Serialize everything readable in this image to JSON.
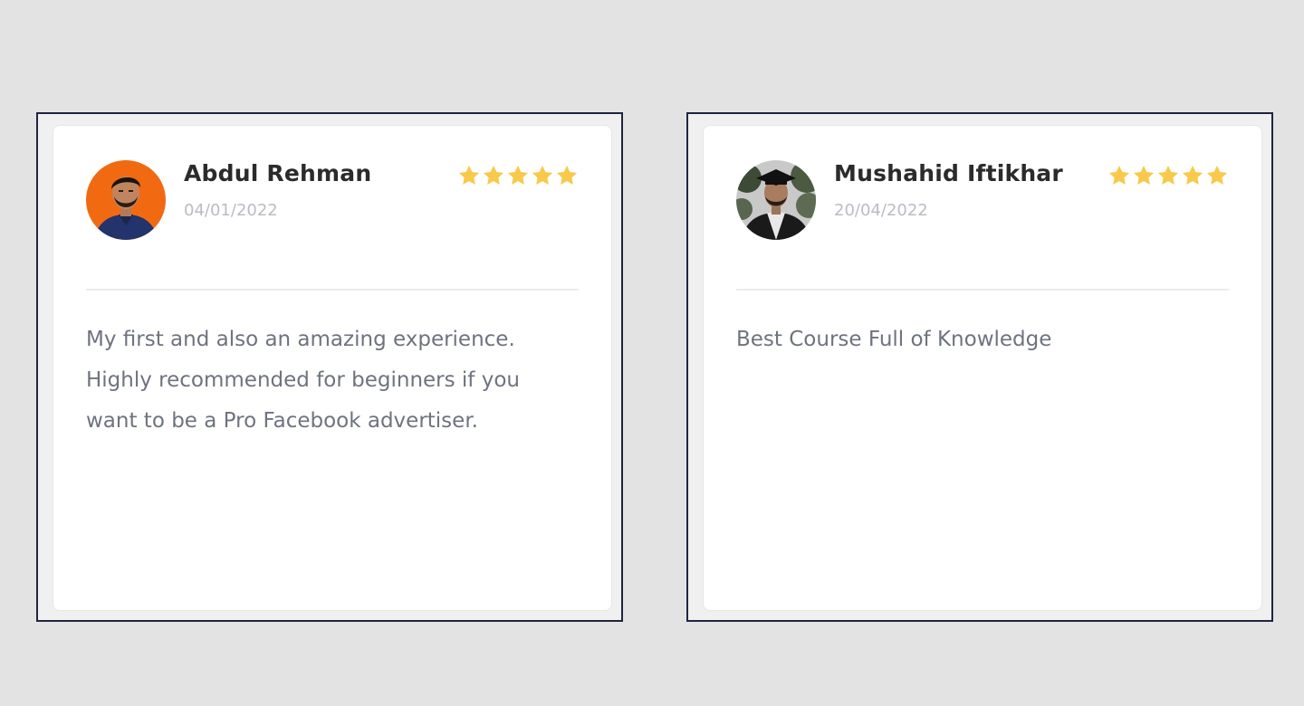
{
  "reviews": [
    {
      "name": "Abdul Rehman",
      "date": "04/01/2022",
      "rating": 5,
      "text": "My first and also an amazing experience. Highly recommended for beginners if you want to be a Pro Facebook advertiser."
    },
    {
      "name": "Mushahid Iftikhar",
      "date": "20/04/2022",
      "rating": 5,
      "text": "Best Course Full of Knowledge"
    }
  ],
  "colors": {
    "star": "#f8c94a",
    "avatar_1_bg": "#f16a12",
    "frame_border": "#1f2540"
  }
}
